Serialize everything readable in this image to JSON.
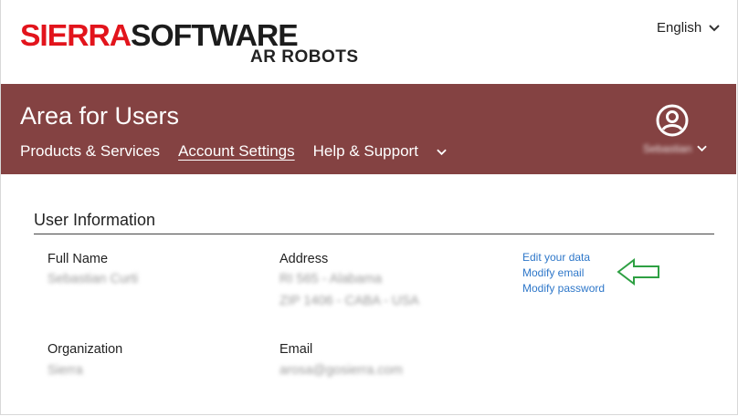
{
  "brand": {
    "name_part1": "SIERRA",
    "name_part2": "SOFTWARE",
    "subtitle": "AR ROBOTS",
    "colors": {
      "red": "#e2141c",
      "dark": "#1c1c1c"
    }
  },
  "language": {
    "selected": "English",
    "icon": "chevron-down-icon"
  },
  "banner": {
    "title": "Area for Users",
    "background": "#844242",
    "nav": [
      {
        "label": "Products & Services",
        "active": false
      },
      {
        "label": "Account Settings",
        "active": true
      },
      {
        "label": "Help & Support",
        "active": false
      }
    ],
    "nav_more_icon": "chevron-down-icon",
    "user": {
      "icon": "user-circle-icon",
      "name": "Sebastian"
    }
  },
  "user_info": {
    "title": "User Information",
    "full_name": {
      "label": "Full Name",
      "value": "Sebastian Curti"
    },
    "address": {
      "label": "Address",
      "line1": "RI 565 - Alabama",
      "line2": "ZIP 1406 - CABA - USA"
    },
    "organization": {
      "label": "Organization",
      "value": "Sierra"
    },
    "email": {
      "label": "Email",
      "value": "arosa@gosierra.com"
    },
    "actions": {
      "edit_data": "Edit your data",
      "modify_email": "Modify email",
      "modify_password": "Modify password"
    },
    "annotation_arrow": {
      "icon": "arrow-left-outline-icon",
      "color": "#2ea043"
    }
  }
}
